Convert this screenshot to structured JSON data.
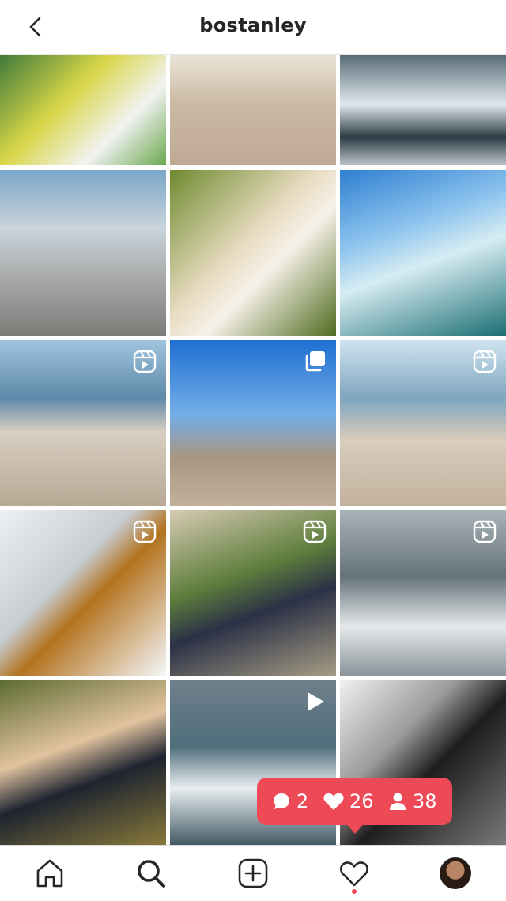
{
  "header": {
    "title": "bostanley"
  },
  "grid": {
    "tiles": [
      {
        "badge": "none",
        "bg": "linear-gradient(135deg,#3f7a3a 0%,#d9d648 40%,#f2f2f2 70%,#6aa84f 100%)"
      },
      {
        "badge": "none",
        "bg": "linear-gradient(180deg,#e9e3d6 0%,#cbb9a3 45%,#bfa994 100%)"
      },
      {
        "badge": "none",
        "bg": "linear-gradient(180deg,#5a6d78 0%,#dfe9ee 45%,#2c3b44 75%,#b7c2c7 100%)"
      },
      {
        "badge": "none",
        "bg": "linear-gradient(180deg,#7aa7c9 0%,#c9d4dc 35%,#a8aaa9 65%,#7d7b78 100%)"
      },
      {
        "badge": "none",
        "bg": "linear-gradient(135deg,#6e8a2e 0%,#e9dcc2 45%,#f6f1e8 60%,#4f6a1f 100%)"
      },
      {
        "badge": "none",
        "bg": "linear-gradient(160deg,#2f7fd1 0%,#8cc3ee 35%,#d6ecf2 55%,#1b6e73 100%)"
      },
      {
        "badge": "reel",
        "bg": "linear-gradient(180deg,#9fc4df 0%,#5f89a8 35%,#d8cfc2 55%,#b7a894 100%)"
      },
      {
        "badge": "carousel",
        "bg": "linear-gradient(180deg,#1f6fd2 0%,#74aee8 45%,#a69683 70%,#c4b09a 100%)"
      },
      {
        "badge": "reel",
        "bg": "linear-gradient(180deg,#cfe3ef 0%,#7fa6bf 35%,#d9cdbc 60%,#c2b29e 100%)"
      },
      {
        "badge": "reel",
        "bg": "linear-gradient(135deg,#eef1f4 0%,#c7ccd1 40%,#b3731f 55%,#f5f7f9 100%)"
      },
      {
        "badge": "reel",
        "bg": "linear-gradient(160deg,#d7cbb3 0%,#5d7d3c 40%,#2b3146 60%,#a79d85 100%)"
      },
      {
        "badge": "reel",
        "bg": "linear-gradient(180deg,#a8b3b8 0%,#66737a 40%,#e4e8ea 70%,#8a9499 100%)"
      },
      {
        "badge": "none",
        "bg": "linear-gradient(160deg,#5d6b33 0%,#e2c39f 40%,#1e2430 60%,#8a7a3a 100%)"
      },
      {
        "badge": "video",
        "bg": "linear-gradient(180deg,#6f7f8b 0%,#4f6f7c 40%,#e9eef0 65%,#3d5662 100%)"
      },
      {
        "badge": "none",
        "bg": "linear-gradient(135deg,#f0f0f0 0%,#9a9a9a 35%,#1e1e1e 55%,#7a7a7a 100%)"
      }
    ]
  },
  "toast": {
    "comments": "2",
    "likes": "26",
    "follows": "38",
    "color": "#ed4956"
  },
  "tabbar": {
    "items": [
      "home",
      "search",
      "create",
      "activity",
      "profile"
    ]
  }
}
